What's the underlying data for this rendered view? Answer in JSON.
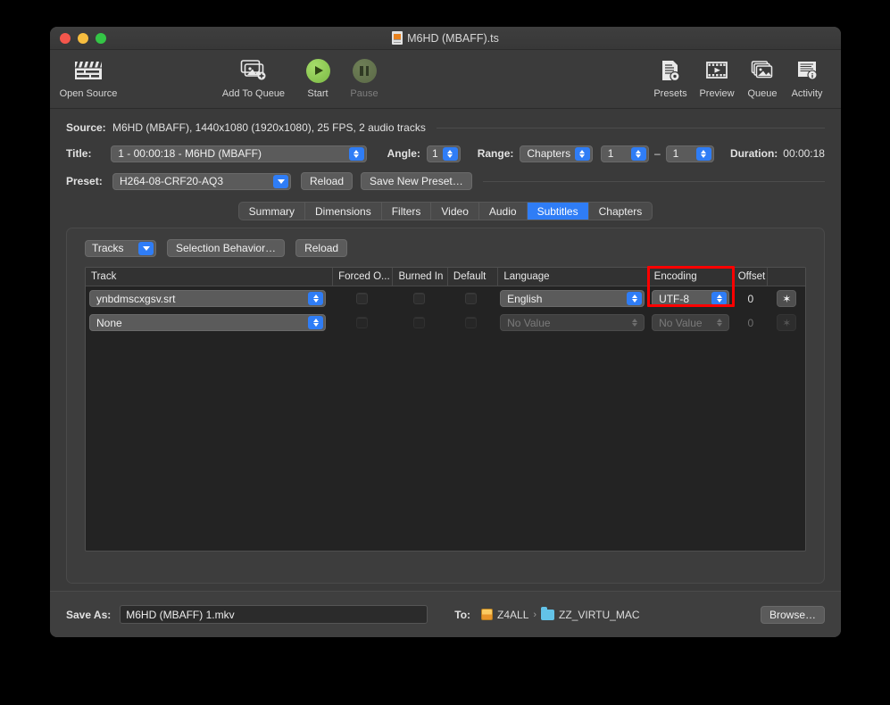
{
  "window": {
    "title": "M6HD (MBAFF).ts"
  },
  "toolbar": {
    "left": [
      {
        "label": "Open Source",
        "icon": "clapperboard-icon",
        "dim": false
      },
      {
        "label": "Add To Queue",
        "icon": "add-to-queue-icon",
        "dim": false
      },
      {
        "label": "Start",
        "icon": "play-icon",
        "dim": false
      },
      {
        "label": "Pause",
        "icon": "pause-icon",
        "dim": true
      }
    ],
    "right": [
      {
        "label": "Presets",
        "icon": "presets-icon"
      },
      {
        "label": "Preview",
        "icon": "preview-icon"
      },
      {
        "label": "Queue",
        "icon": "queue-icon"
      },
      {
        "label": "Activity",
        "icon": "activity-icon"
      }
    ]
  },
  "source": {
    "label": "Source:",
    "value": "M6HD (MBAFF), 1440x1080 (1920x1080), 25 FPS, 2 audio tracks"
  },
  "title_row": {
    "label": "Title:",
    "value": "1 - 00:00:18 - M6HD (MBAFF)",
    "angle_label": "Angle:",
    "angle_value": "1",
    "range_label": "Range:",
    "range_type": "Chapters",
    "range_start": "1",
    "range_dash": "–",
    "range_end": "1",
    "duration_label": "Duration:",
    "duration_value": "00:00:18"
  },
  "preset_row": {
    "label": "Preset:",
    "value": "H264-08-CRF20-AQ3",
    "reload_label": "Reload",
    "save_new_label": "Save New Preset…"
  },
  "tabs": [
    {
      "label": "Summary",
      "active": false
    },
    {
      "label": "Dimensions",
      "active": false
    },
    {
      "label": "Filters",
      "active": false
    },
    {
      "label": "Video",
      "active": false
    },
    {
      "label": "Audio",
      "active": false
    },
    {
      "label": "Subtitles",
      "active": true
    },
    {
      "label": "Chapters",
      "active": false
    }
  ],
  "subtitles_panel": {
    "tracks_popup": "Tracks",
    "selection_behavior_label": "Selection Behavior…",
    "reload_label": "Reload",
    "columns": [
      "Track",
      "Forced O...",
      "Burned In",
      "Default",
      "Language",
      "Encoding",
      "Offset",
      ""
    ],
    "rows": [
      {
        "track": "ynbdmscxgsv.srt",
        "forced_only": false,
        "burned_in": false,
        "default": false,
        "language": "English",
        "encoding": "UTF-8",
        "offset": "0",
        "gear": "gear-icon",
        "enabled": true
      },
      {
        "track": "None",
        "forced_only": false,
        "burned_in": false,
        "default": false,
        "language": "No Value",
        "encoding": "No Value",
        "offset": "0",
        "gear": "gear-icon",
        "enabled": false
      }
    ],
    "highlight": {
      "column": "Encoding",
      "color": "#fe0000"
    }
  },
  "bottom": {
    "save_as_label": "Save As:",
    "save_as_value": "M6HD (MBAFF) 1.mkv",
    "to_label": "To:",
    "path_drive": "Z4ALL",
    "path_separator": "›",
    "path_folder": "ZZ_VIRTU_MAC",
    "browse_label": "Browse…"
  },
  "colors": {
    "accent": "#2f7df6",
    "highlight": "#fe0000",
    "window_bg": "#3a3a3a",
    "table_bg": "#232323",
    "start_green": "#7bb945"
  }
}
